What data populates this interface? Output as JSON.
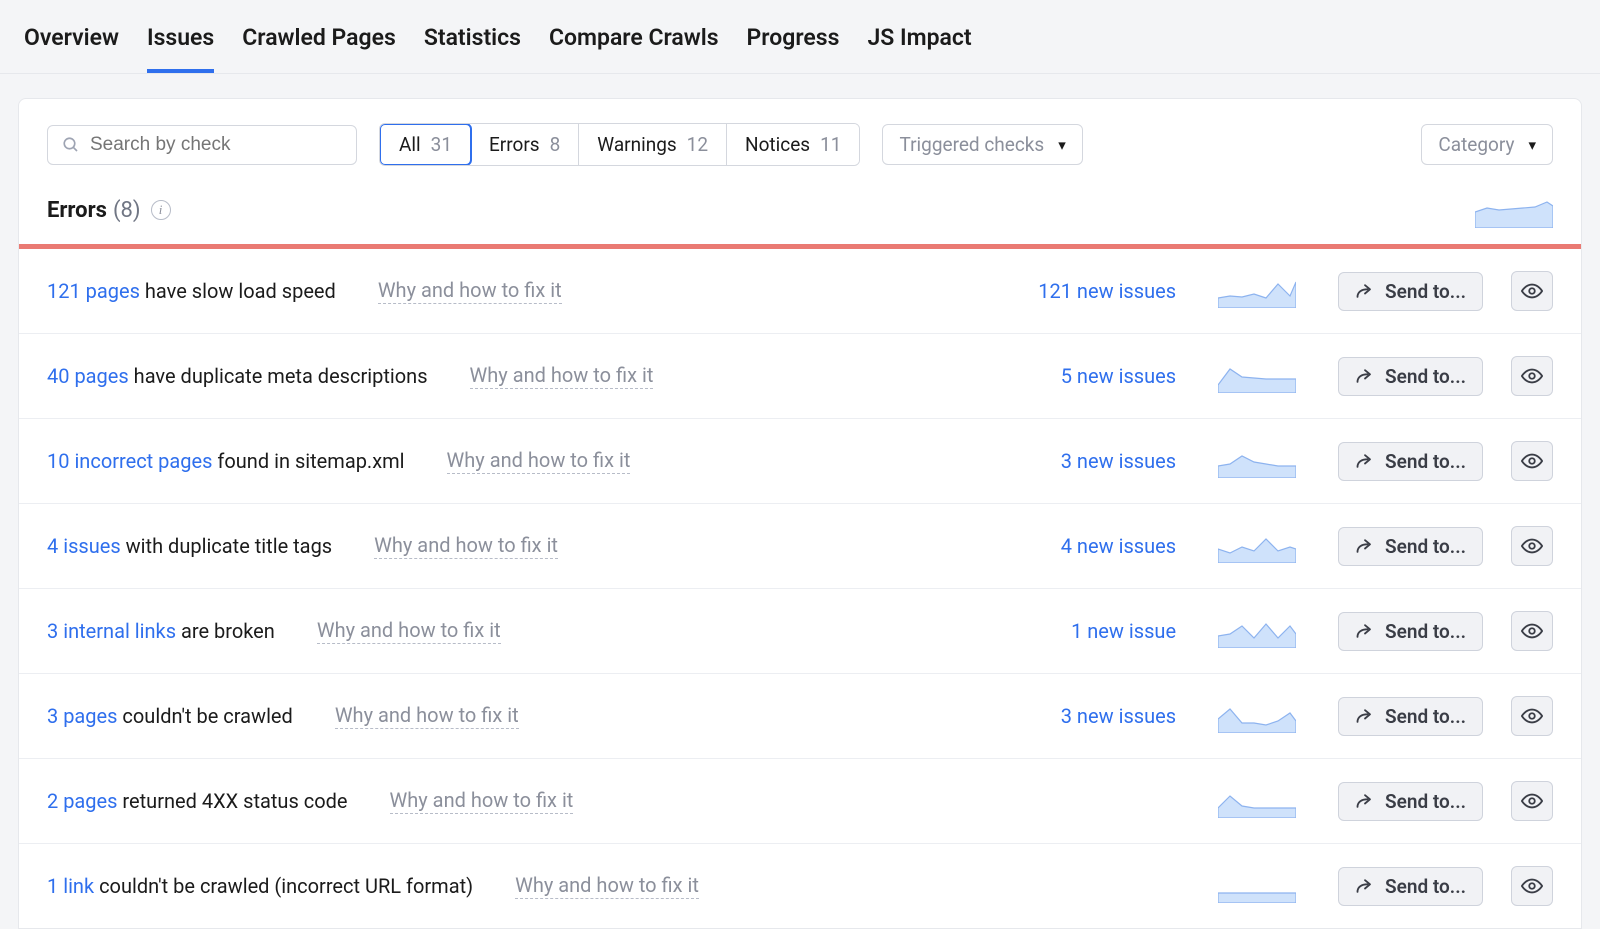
{
  "nav": {
    "tabs": [
      {
        "label": "Overview",
        "active": false
      },
      {
        "label": "Issues",
        "active": true
      },
      {
        "label": "Crawled Pages",
        "active": false
      },
      {
        "label": "Statistics",
        "active": false
      },
      {
        "label": "Compare Crawls",
        "active": false
      },
      {
        "label": "Progress",
        "active": false
      },
      {
        "label": "JS Impact",
        "active": false
      }
    ]
  },
  "controls": {
    "search_placeholder": "Search by check",
    "segments": [
      {
        "label": "All",
        "count": "31",
        "active": true
      },
      {
        "label": "Errors",
        "count": "8",
        "active": false
      },
      {
        "label": "Warnings",
        "count": "12",
        "active": false
      },
      {
        "label": "Notices",
        "count": "11",
        "active": false
      }
    ],
    "triggered_label": "Triggered checks",
    "category_label": "Category"
  },
  "section": {
    "title": "Errors",
    "count": "(8)"
  },
  "rows": [
    {
      "link": "121 pages",
      "rest": " have slow load speed",
      "fix": "Why and how to fix it",
      "new": "121 new issues"
    },
    {
      "link": "40 pages",
      "rest": " have duplicate meta descriptions",
      "fix": "Why and how to fix it",
      "new": "5 new issues"
    },
    {
      "link": "10 incorrect pages",
      "rest": " found in sitemap.xml",
      "fix": "Why and how to fix it",
      "new": "3 new issues"
    },
    {
      "link": "4 issues",
      "rest": " with duplicate title tags",
      "fix": "Why and how to fix it",
      "new": "4 new issues"
    },
    {
      "link": "3 internal links",
      "rest": " are broken",
      "fix": "Why and how to fix it",
      "new": "1 new issue"
    },
    {
      "link": "3 pages",
      "rest": " couldn't be crawled",
      "fix": "Why and how to fix it",
      "new": "3 new issues"
    },
    {
      "link": "2 pages",
      "rest": " returned 4XX status code",
      "fix": "Why and how to fix it",
      "new": ""
    },
    {
      "link": "1 link",
      "rest": " couldn't be crawled (incorrect URL format)",
      "fix": "Why and how to fix it",
      "new": ""
    }
  ],
  "buttons": {
    "send_to": "Send to..."
  },
  "sparks": {
    "header": "0,20 12,16 24,18 36,17 48,16 60,15 72,10 78,14",
    "rows": [
      "0,24 12,22 24,23 36,20 48,24 60,10 72,22 78,8",
      "0,26 12,10 24,18 36,19 48,20 60,20 72,20 78,20",
      "0,22 12,20 24,12 36,18 48,20 60,22 72,22 78,22",
      "0,20 12,24 24,18 36,22 48,10 60,22 72,18 78,20",
      "0,22 12,20 24,12 36,24 48,10 60,24 72,12 78,20",
      "0,20 12,10 24,24 36,24 48,26 60,22 72,14 78,22",
      "0,24 12,12 24,22 36,24 48,24 60,24 72,24 78,24",
      "0,24 12,24 24,24 36,24 48,24 60,24 72,24 78,24"
    ]
  }
}
